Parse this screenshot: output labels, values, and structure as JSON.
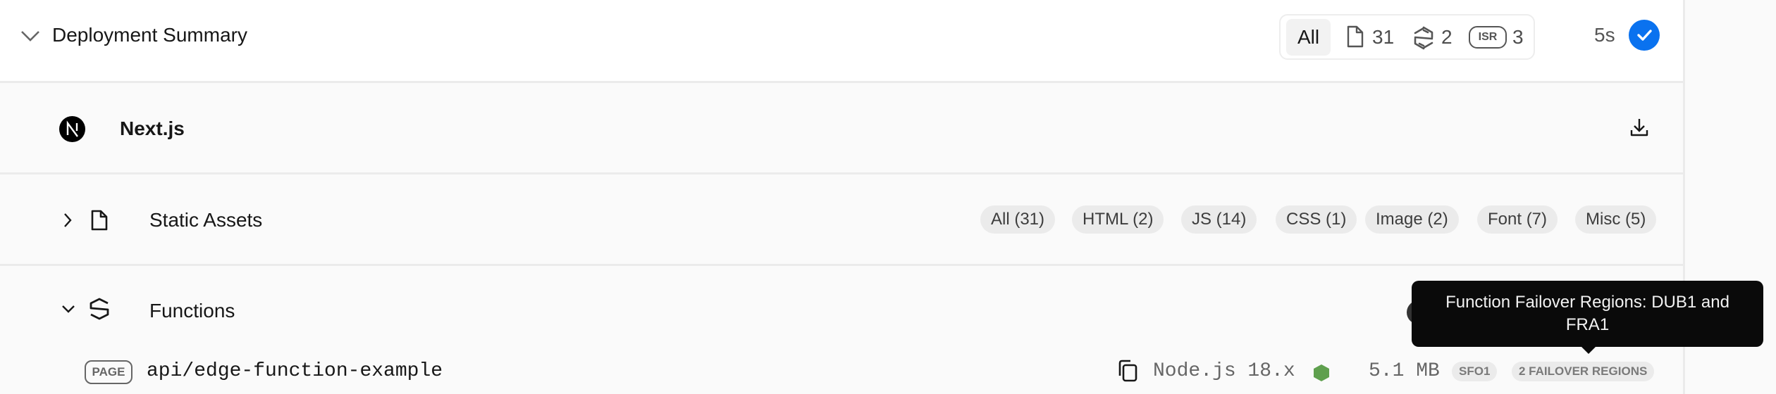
{
  "header": {
    "title": "Deployment Summary",
    "filter": {
      "all_label": "All",
      "static_count": "31",
      "functions_count": "2",
      "isr_label": "ISR",
      "isr_count": "3"
    },
    "duration": "5s",
    "status": "ready",
    "status_color": "#0a72ef"
  },
  "framework": {
    "name": "Next.js",
    "logo_letter": "N"
  },
  "static_assets": {
    "title": "Static Assets",
    "expanded": false,
    "filters": [
      {
        "label": "All (31)"
      },
      {
        "label": "HTML (2)"
      },
      {
        "label": "JS (14)"
      },
      {
        "label": "CSS (1)"
      },
      {
        "label": "Image (2)"
      },
      {
        "label": "Font (7)"
      },
      {
        "label": "Misc (5)"
      }
    ]
  },
  "functions": {
    "title": "Functions",
    "expanded": true,
    "items": [
      {
        "type_badge": "PAGE",
        "route": "api/edge-function-example",
        "runtime": "Node.js 18.x",
        "runtime_color": "#5fa04e",
        "size": "5.1 MB",
        "region": "SFO1",
        "failover": "2 FAILOVER REGIONS"
      }
    ]
  },
  "tooltip": {
    "text": "Function Failover Regions: DUB1 and FRA1"
  }
}
